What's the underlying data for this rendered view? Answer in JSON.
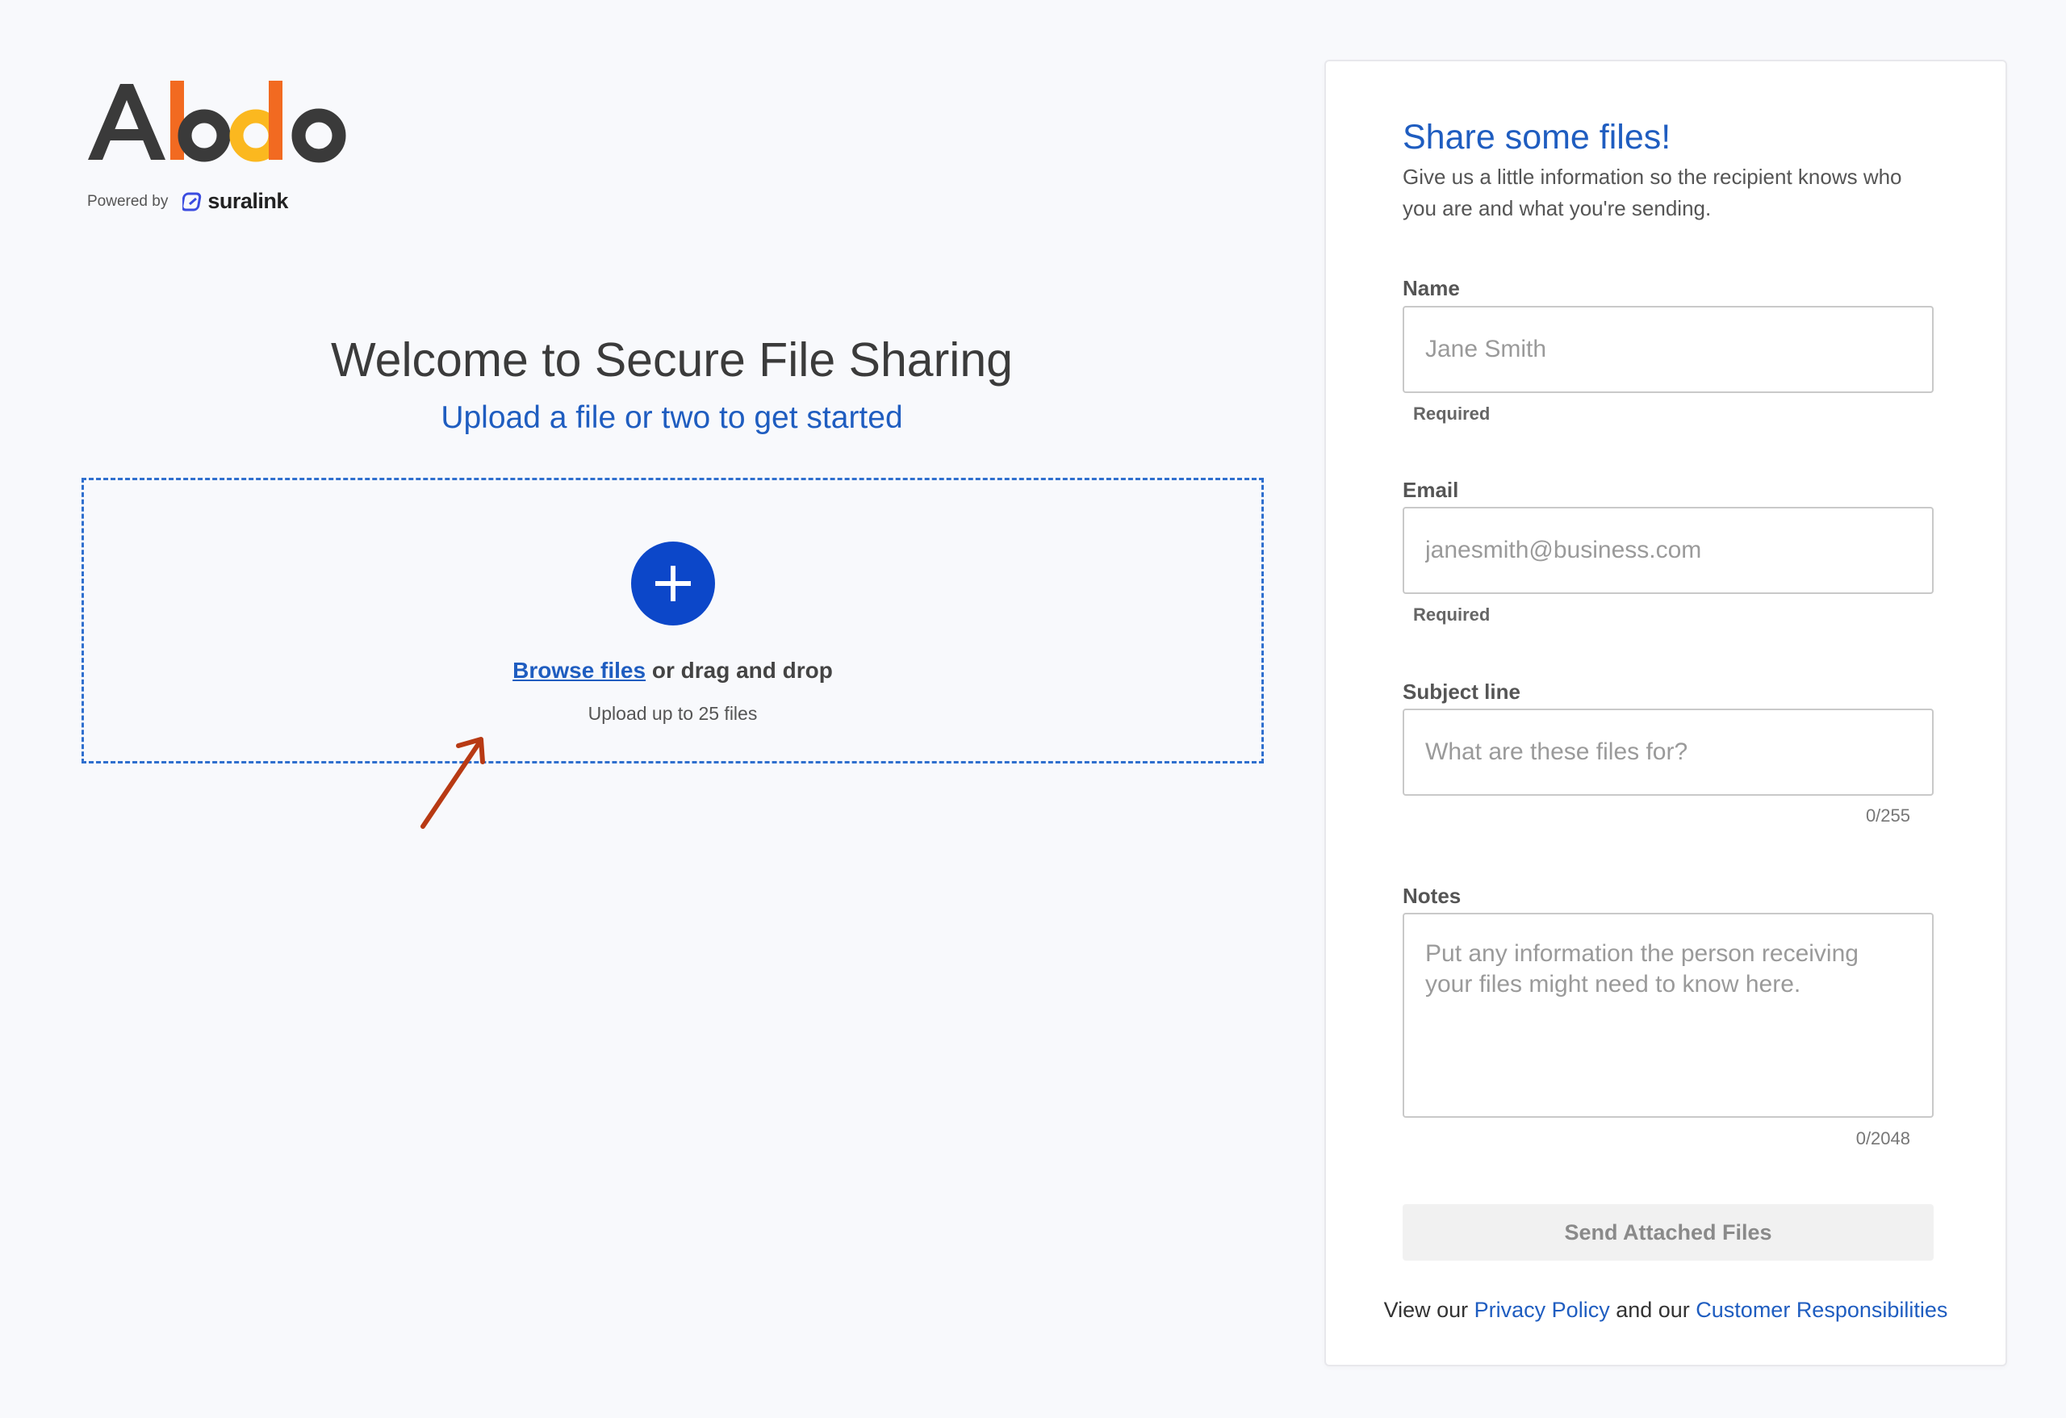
{
  "logo": {
    "wordmark": "Abdo",
    "powered_by": "Powered by",
    "partner": "suralink",
    "colors": {
      "dark": "#3a3a3a",
      "orange": "#f26a21",
      "yellow": "#fbb81f",
      "partner_icon": "#3b4ce0"
    }
  },
  "welcome": {
    "title": "Welcome to Secure File Sharing",
    "subtitle": "Upload a file or two to get started"
  },
  "dropzone": {
    "browse_label": "Browse files",
    "drag_text": " or drag and drop",
    "limit_text": "Upload up to 25 files",
    "add_icon": "plus-icon",
    "accent": "#0c47c9"
  },
  "annotation": {
    "icon": "arrow-icon",
    "color": "#b83a14"
  },
  "form": {
    "title": "Share some files!",
    "description": "Give us a little information so the recipient knows who you are and what you're sending.",
    "name": {
      "label": "Name",
      "placeholder": "Jane Smith",
      "helper": "Required",
      "value": ""
    },
    "email": {
      "label": "Email",
      "placeholder": "janesmith@business.com",
      "helper": "Required",
      "value": ""
    },
    "subject": {
      "label": "Subject line",
      "placeholder": "What are these files for?",
      "counter": "0/255",
      "value": ""
    },
    "notes": {
      "label": "Notes",
      "placeholder": "Put any information the person receiving your files might need to know here.",
      "counter": "0/2048",
      "value": ""
    },
    "submit_label": "Send Attached Files",
    "footer": {
      "prefix": "View our ",
      "privacy_label": "Privacy Policy",
      "middle": " and our ",
      "responsibilities_label": "Customer Responsibilities"
    }
  }
}
